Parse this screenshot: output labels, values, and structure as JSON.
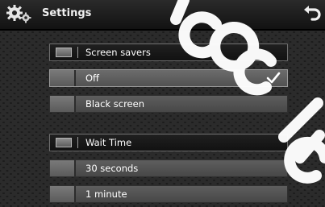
{
  "header": {
    "title": "Settings",
    "icon": "gears-icon",
    "back_icon": "back-arrow-icon"
  },
  "sections": [
    {
      "title": "Screen savers",
      "options": [
        {
          "label": "Off",
          "selected": true
        },
        {
          "label": "Black screen",
          "selected": false
        }
      ]
    },
    {
      "title": "Wait Time",
      "options": [
        {
          "label": "30 seconds",
          "selected": false
        },
        {
          "label": "1 minute",
          "selected": false
        }
      ]
    }
  ],
  "colors": {
    "background": "#181818",
    "option_row": "#555555",
    "section_border": "#6e6e6e",
    "text": "#ffffff"
  }
}
